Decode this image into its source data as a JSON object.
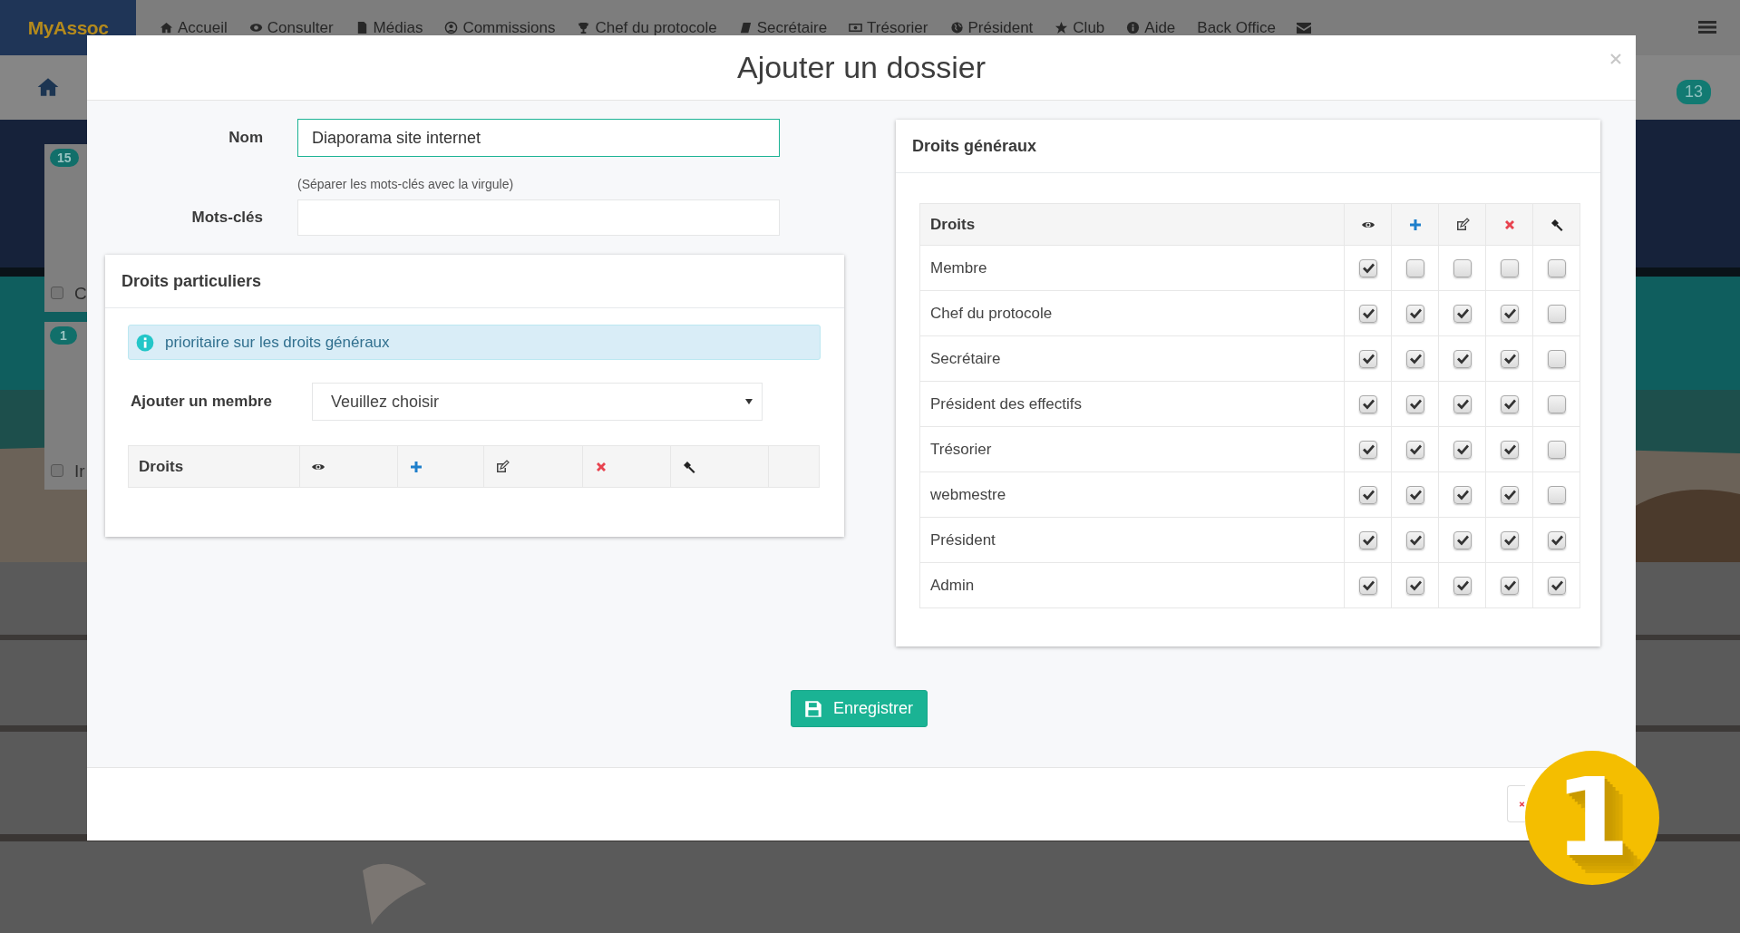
{
  "nav": {
    "logo": "MyAssoc",
    "items": [
      {
        "label": "Accueil"
      },
      {
        "label": "Consulter"
      },
      {
        "label": "Médias"
      },
      {
        "label": "Commissions"
      },
      {
        "label": "Chef du protocole"
      },
      {
        "label": "Secrétaire"
      },
      {
        "label": "Trésorier"
      },
      {
        "label": "Président"
      },
      {
        "label": "Club"
      },
      {
        "label": "Aide"
      },
      {
        "label": "Back Office"
      }
    ]
  },
  "subbar": {
    "badge": "13"
  },
  "background_cards": [
    {
      "badge": "15",
      "label": "C",
      "checked": false
    },
    {
      "badge": "1",
      "label": "Ir",
      "checked": false
    }
  ],
  "modal": {
    "title": "Ajouter un dossier",
    "form": {
      "name_label": "Nom",
      "name_value": "Diaporama site internet",
      "keywords_hint": "(Séparer les mots-clés avec la virgule)",
      "keywords_label": "Mots-clés"
    },
    "particular_rights": {
      "title": "Droits particuliers",
      "info": "prioritaire sur les droits généraux",
      "add_member_label": "Ajouter un membre",
      "select_value": "Veuillez choisir",
      "table_header": "Droits"
    },
    "general_rights": {
      "title": "Droits généraux",
      "table_header": "Droits",
      "rows": [
        {
          "name": "Membre",
          "rights": [
            true,
            false,
            false,
            false,
            false
          ]
        },
        {
          "name": "Chef du protocole",
          "rights": [
            true,
            true,
            true,
            true,
            false
          ]
        },
        {
          "name": "Secrétaire",
          "rights": [
            true,
            true,
            true,
            true,
            false
          ]
        },
        {
          "name": "Président des effectifs",
          "rights": [
            true,
            true,
            true,
            true,
            false
          ]
        },
        {
          "name": "Trésorier",
          "rights": [
            true,
            true,
            true,
            true,
            false
          ]
        },
        {
          "name": "webmestre",
          "rights": [
            true,
            true,
            true,
            true,
            false
          ]
        },
        {
          "name": "Président",
          "rights": [
            true,
            true,
            true,
            true,
            true
          ]
        },
        {
          "name": "Admin",
          "rights": [
            true,
            true,
            true,
            true,
            true
          ]
        }
      ]
    },
    "save_button": "Enregistrer"
  },
  "step_badge": "1"
}
